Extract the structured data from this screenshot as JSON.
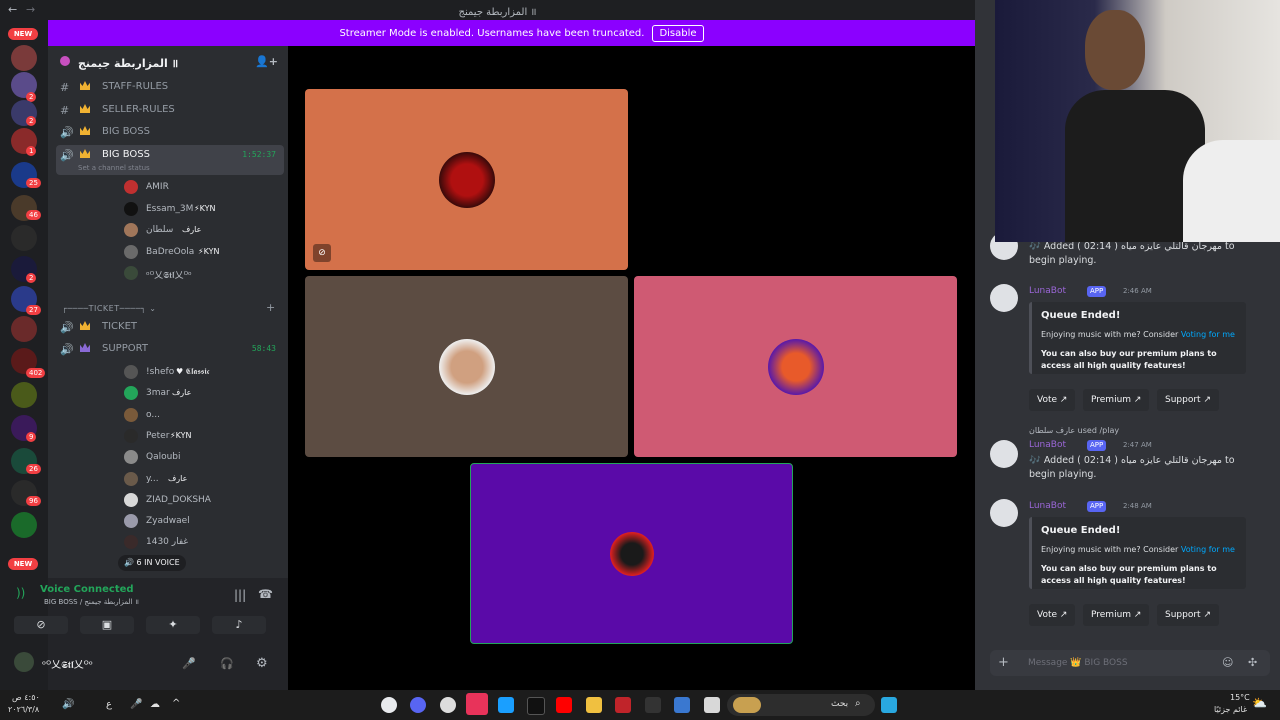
{
  "window": {
    "title": "المزاربطة جيمنج ॥"
  },
  "banner": {
    "text": "Streamer Mode is enabled. Usernames have been truncated.",
    "button": "Disable"
  },
  "rail": {
    "new_top": "NEW",
    "new_bottom": "NEW",
    "badges": [
      "2",
      "2",
      "1",
      "25",
      "46",
      "2",
      "2",
      "27",
      "402",
      "9",
      "26",
      "96"
    ]
  },
  "server": {
    "name": "المزاربطة جيمنج ॥"
  },
  "channels": [
    {
      "label": "STAFF-RULES",
      "icon": "#"
    },
    {
      "label": "SELLER-RULES",
      "icon": "#"
    },
    {
      "label": "BIG BOSS",
      "icon": "🔊"
    },
    {
      "label": "BIG BOSS",
      "icon": "🔊",
      "timer": "1:52:37",
      "status": "Set a channel status"
    }
  ],
  "bigboss_users": [
    {
      "name": "AMIR",
      "tag": ""
    },
    {
      "name": "Essam_3M",
      "tag": "⚡KYN"
    },
    {
      "name": "سلطان",
      "tag": "عارف"
    },
    {
      "name": "BaDreOola",
      "tag": "⚡KYN"
    },
    {
      "name": "ᵒᴼ乂𝕾𝖙𝖑乂ᴼᵒ",
      "tag": ""
    }
  ],
  "ticket_category": "TICKET",
  "ticket_channels": [
    {
      "label": "TICKET"
    },
    {
      "label": "SUPPORT",
      "timer": "58:43"
    }
  ],
  "support_users": [
    {
      "name": "!shefo",
      "tag": "♥ 𝕮𝖑𝖆𝖘𝖘𝖎𝖈"
    },
    {
      "name": "3mar",
      "tag": "عارف"
    },
    {
      "name": "o...",
      "tag": ""
    },
    {
      "name": "Peter",
      "tag": "⚡KYN"
    },
    {
      "name": "Qaloubi",
      "tag": ""
    },
    {
      "name": "y...",
      "tag": "عارف"
    },
    {
      "name": "ZIAD_DOKSHA",
      "tag": ""
    },
    {
      "name": "Zyadwael",
      "tag": ""
    },
    {
      "name": "غفار 1430",
      "tag": ""
    }
  ],
  "in_voice": "6 IN VOICE",
  "voice": {
    "status": "Voice Connected",
    "channel": "BIG BOSS / المزاربطة جيمنج ॥",
    "me": "ᵒᴼ乂𝕾𝖙𝖑乂ᴼᵒ"
  },
  "stage": {
    "colors": {
      "tile1": "#d4714a",
      "tile2": "#5c4c42",
      "tile3": "#cf5a73",
      "tile4": "#5a0aa8"
    }
  },
  "chat": {
    "msg1_text": "🎶 Added ( 02:14 ) مهرجان قالتلي عايزه مياه to begin playing.",
    "bot_name": "LunaBot",
    "app": "APP",
    "time2": "2:46 AM",
    "embed_title": "Queue Ended!",
    "embed_desc_pre": "Enjoying music with me? Consider ",
    "embed_desc_link": "Voting for me",
    "embed_desc2": "You can also buy our premium plans to access all high quality features!",
    "btn_vote": "Vote ↗",
    "btn_premium": "Premium ↗",
    "btn_support": "Support ↗",
    "used_line": "عارف سلطان used /play",
    "time3": "2:47 AM",
    "time4": "2:48 AM",
    "msg_placeholder": "Message 👑 BIG BOSS"
  },
  "taskbar": {
    "time": "٤:٥٠ ص",
    "date": "٢٠٢٦/٣/٨",
    "weather": "15°C",
    "weather_desc": "غائم جزئيًا",
    "search": "بحث",
    "lang": "ع"
  }
}
